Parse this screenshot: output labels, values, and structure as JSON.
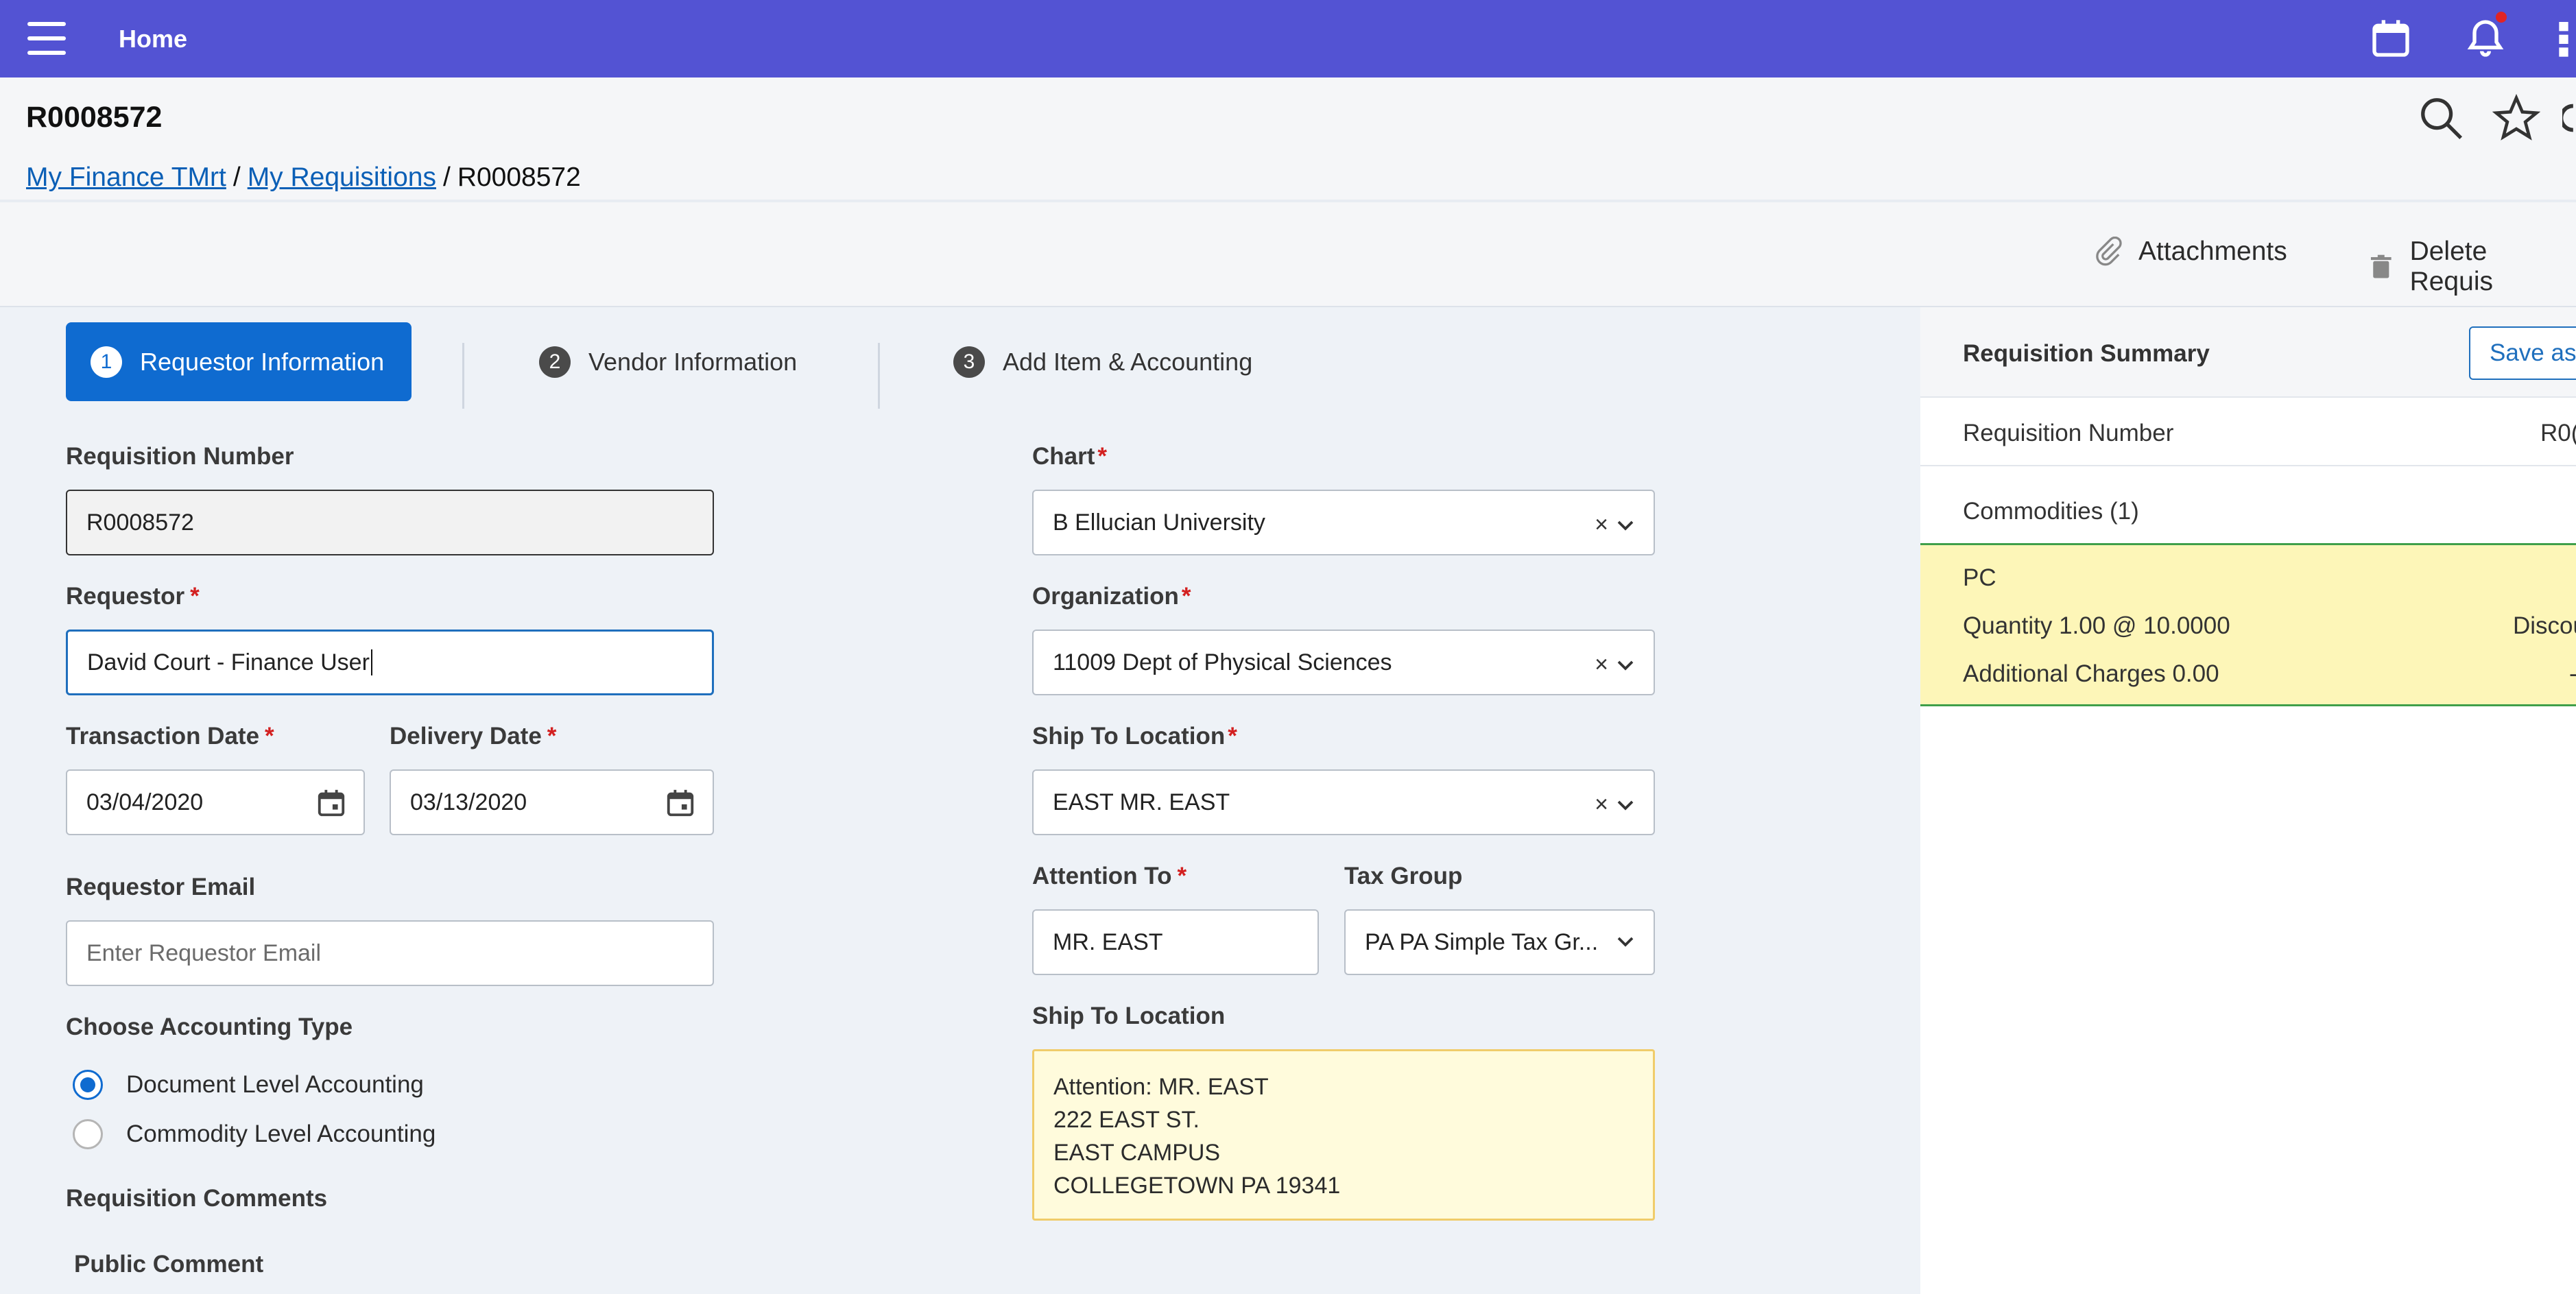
{
  "topbar": {
    "home_label": "Home",
    "icons": [
      "menu-icon",
      "calendar-icon",
      "bell-icon",
      "apps-grid-icon"
    ],
    "accent": "#5353d3"
  },
  "page": {
    "title": "R0008572",
    "breadcrumb": [
      {
        "label": "My Finance TMrt",
        "link": true
      },
      {
        "label": "My Requisitions",
        "link": true
      },
      {
        "label": "R0008572",
        "link": false
      }
    ],
    "breadcrumb_sep": "/"
  },
  "actions": {
    "attachments": "Attachments",
    "delete": "Delete Requis"
  },
  "steps": [
    {
      "num": "1",
      "label": "Requestor Information",
      "active": true
    },
    {
      "num": "2",
      "label": "Vendor Information",
      "active": false
    },
    {
      "num": "3",
      "label": "Add Item & Accounting",
      "active": false
    }
  ],
  "form": {
    "requisition_number": {
      "label": "Requisition Number",
      "value": "R0008572"
    },
    "requestor": {
      "label": "Requestor",
      "value": "David Court - Finance User",
      "required_mark": "*"
    },
    "transaction_date": {
      "label": "Transaction Date",
      "value": "03/04/2020",
      "required_mark": "*"
    },
    "delivery_date": {
      "label": "Delivery Date",
      "value": "03/13/2020",
      "required_mark": "*"
    },
    "requestor_email": {
      "label": "Requestor Email",
      "placeholder": "Enter Requestor Email"
    },
    "accounting_type": {
      "label": "Choose Accounting Type",
      "options": [
        {
          "label": "Document Level Accounting",
          "checked": true
        },
        {
          "label": "Commodity Level Accounting",
          "checked": false
        }
      ]
    },
    "requisition_comments": "Requisition Comments",
    "public_comment": "Public Comment",
    "chart": {
      "label": "Chart",
      "value": "B Ellucian University",
      "required_mark": "*"
    },
    "organization": {
      "label": "Organization",
      "value": "11009 Dept of Physical Sciences",
      "required_mark": "*"
    },
    "ship_to": {
      "label": "Ship To Location",
      "value": "EAST MR. EAST",
      "required_mark": "*"
    },
    "attention_to": {
      "label": "Attention To",
      "value": "MR. EAST",
      "required_mark": "*"
    },
    "tax_group": {
      "label": "Tax Group",
      "value": "PA PA Simple Tax Gr..."
    },
    "ship_to_address": {
      "label": "Ship To Location",
      "lines": [
        "Attention: MR. EAST",
        "222 EAST ST.",
        "EAST CAMPUS",
        "COLLEGETOWN PA 19341"
      ]
    }
  },
  "summary": {
    "title": "Requisition Summary",
    "save_label": "Save as",
    "requisition_number_label": "Requisition Number",
    "requisition_number_value": "R0(",
    "commodities_label": "Commodities (1)",
    "commodity": {
      "name": "PC",
      "quantity": "Quantity 1.00 @ 10.0000",
      "discount": "Discou",
      "additional": "Additional Charges 0.00",
      "additional_value": "-"
    }
  },
  "icons": {
    "clear": "×"
  }
}
